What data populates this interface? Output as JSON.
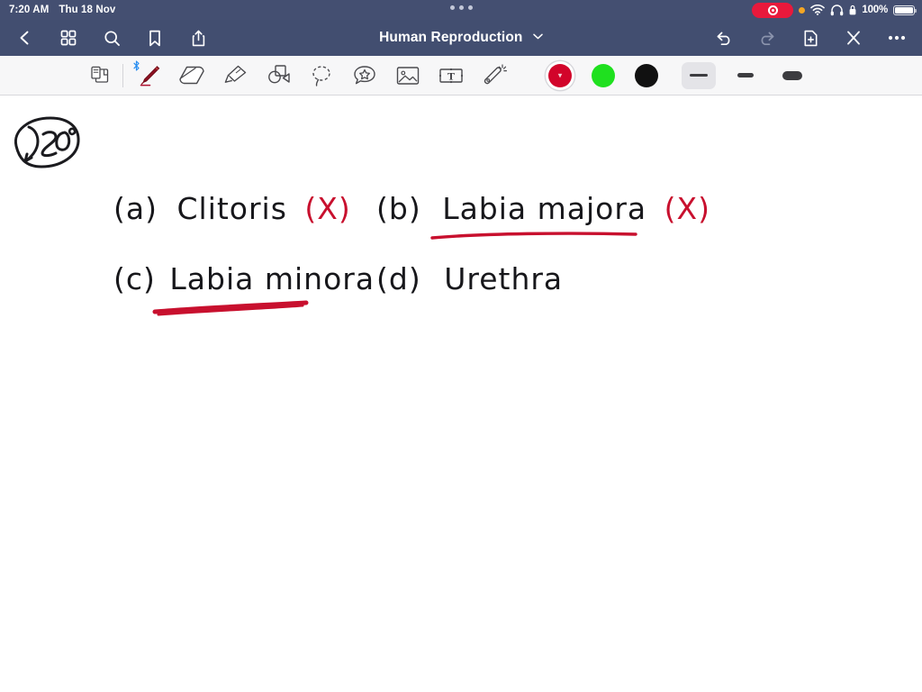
{
  "status_bar": {
    "time": "7:20 AM",
    "date": "Thu 18 Nov",
    "battery_percent": "100%",
    "icons": [
      "screen-recording-pill",
      "orange-privacy-dot",
      "wifi-icon",
      "headphones-icon",
      "lock-icon",
      "battery-icon"
    ],
    "accent_recording": "#e8193c",
    "accent_privacy": "#f5a623",
    "bar_background": "#444f71"
  },
  "nav_bar": {
    "background": "#424e70",
    "title": "Human Reproduction",
    "title_chevron": "chevron-down-icon",
    "left_buttons": [
      {
        "name": "back-button",
        "icon": "chevron-left-icon"
      },
      {
        "name": "library-grid-button",
        "icon": "grid-icon"
      },
      {
        "name": "search-button",
        "icon": "search-icon"
      },
      {
        "name": "bookmark-button",
        "icon": "bookmark-icon"
      },
      {
        "name": "share-button",
        "icon": "share-icon"
      }
    ],
    "right_buttons": [
      {
        "name": "undo-button",
        "icon": "undo-icon",
        "enabled": "true"
      },
      {
        "name": "redo-button",
        "icon": "redo-icon",
        "enabled": "false"
      },
      {
        "name": "add-page-button",
        "icon": "add-page-icon"
      },
      {
        "name": "close-button",
        "icon": "close-x-icon"
      },
      {
        "name": "more-button",
        "icon": "ellipsis-icon"
      }
    ]
  },
  "toolbar": {
    "background": "#f7f7f8",
    "tools": [
      {
        "name": "page-navigator-tool",
        "icon": "page-flip-icon",
        "selected": "false"
      },
      {
        "name": "pen-tool",
        "icon": "pen-icon",
        "selected": "true",
        "badge": "bluetooth-icon"
      },
      {
        "name": "eraser-tool",
        "icon": "eraser-icon",
        "selected": "false"
      },
      {
        "name": "highlighter-tool",
        "icon": "highlighter-icon",
        "selected": "false"
      },
      {
        "name": "shapes-tool",
        "icon": "shapes-icon",
        "selected": "false"
      },
      {
        "name": "lasso-tool",
        "icon": "lasso-icon",
        "selected": "false"
      },
      {
        "name": "sticker-tool",
        "icon": "sticker-star-icon",
        "selected": "false"
      },
      {
        "name": "image-tool",
        "icon": "image-icon",
        "selected": "false"
      },
      {
        "name": "text-tool",
        "icon": "text-box-icon",
        "selected": "false"
      },
      {
        "name": "magic-wand-tool",
        "icon": "magic-wand-icon",
        "selected": "false"
      }
    ],
    "colors": [
      {
        "name": "color-swatch-red",
        "hex": "#d2042a",
        "selected": "true"
      },
      {
        "name": "color-swatch-green",
        "hex": "#1fe01f",
        "selected": "false"
      },
      {
        "name": "color-swatch-black",
        "hex": "#111111",
        "selected": "false"
      }
    ],
    "stroke_widths": [
      {
        "name": "stroke-width-thin",
        "selected": "true"
      },
      {
        "name": "stroke-width-medium",
        "selected": "false"
      },
      {
        "name": "stroke-width-thick",
        "selected": "false"
      }
    ]
  },
  "canvas": {
    "page_number_annotation": "280",
    "ink_black": "#1b1b1f",
    "ink_red": "#c8102e",
    "answers": [
      {
        "label": "(a)",
        "text": "Clitoris",
        "mark": "(X)",
        "mark_color": "#c8102e",
        "underlined": "false"
      },
      {
        "label": "(b)",
        "text": "Labia majora",
        "mark": "(X)",
        "mark_color": "#c8102e",
        "underlined": "true"
      },
      {
        "label": "(c)",
        "text": "Labia minora",
        "mark": "",
        "mark_color": "#c8102e",
        "underlined": "true"
      },
      {
        "label": "(d)",
        "text": "Urethra",
        "mark": "",
        "mark_color": "#c8102e",
        "underlined": "false"
      }
    ]
  }
}
